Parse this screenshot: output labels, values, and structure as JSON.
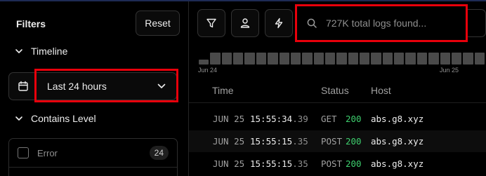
{
  "sidebar": {
    "title": "Filters",
    "reset_label": "Reset",
    "timeline_label": "Timeline",
    "time_range_value": "Last 24 hours",
    "contains_level_label": "Contains Level",
    "levels": [
      {
        "label": "Error",
        "count": "24"
      }
    ]
  },
  "toolbar": {
    "search_placeholder": "727K total logs found..."
  },
  "histogram": {
    "start_label": "Jun 24",
    "end_label": "Jun 25",
    "bar_color": "#4a4a4a",
    "levels": [
      0.35,
      0.85,
      0.85,
      0.85,
      0.85,
      0.85,
      0.85,
      0.85,
      0.85,
      0.85,
      0.85,
      0.85,
      0.85,
      0.85,
      0.85,
      0.85,
      0.85,
      0.85,
      0.85,
      0.85,
      0.85,
      0.85,
      0.85,
      0.85,
      0.85
    ]
  },
  "table": {
    "columns": [
      "Time",
      "Status",
      "Host"
    ],
    "rows": [
      {
        "date": "JUN 25",
        "time": "15:55:34",
        "ms": ".39",
        "method": "GET",
        "status": "200",
        "host": "abs.g8.xyz"
      },
      {
        "date": "JUN 25",
        "time": "15:55:15",
        "ms": ".35",
        "method": "POST",
        "status": "200",
        "host": "abs.g8.xyz"
      },
      {
        "date": "JUN 25",
        "time": "15:55:15",
        "ms": ".35",
        "method": "POST",
        "status": "200",
        "host": "abs.g8.xyz"
      }
    ]
  },
  "colors": {
    "highlight": "#e8000b",
    "status_ok": "#3ecf6e",
    "top_border": "#1d2b55"
  }
}
